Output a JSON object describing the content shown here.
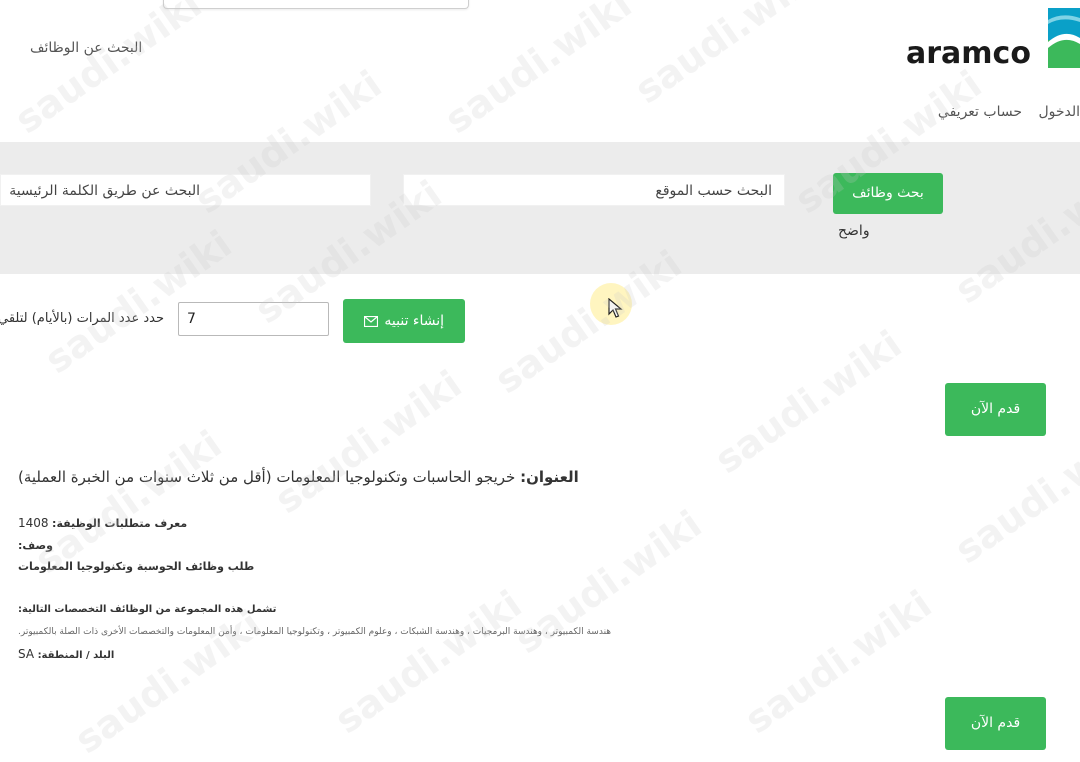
{
  "header": {
    "job_search_link": "البحث عن الوظائف",
    "logo_text": "aramco",
    "nav_items": [
      "الدخول",
      "حساب تعريفي"
    ]
  },
  "search": {
    "keyword_placeholder": "البحث عن طريق الكلمة الرئيسية",
    "location_placeholder": "البحث حسب الموقع",
    "search_button": "بحث وظائف",
    "clear_link": "واضح"
  },
  "alert": {
    "label": "حدد عدد المرات (بالأيام) لتلقي",
    "frequency_value": "7",
    "create_button": "إنشاء تنبيه"
  },
  "jobs": [
    {
      "apply_button": "قدم الآن",
      "title_label": "العنوان:",
      "title": "خريجو الحاسبات وتكنولوجيا المعلومات (أقل من ثلاث سنوات من الخبرة العملية)",
      "req_id_label": "معرف متطلبات الوظيفة:",
      "req_id": "1408",
      "description_label": "وصف:",
      "description": "طلب وظائف الحوسبة وتكنولوجيا المعلومات",
      "includes_label": "تشمل هذه المجموعة من الوظائف التخصصات التالية:",
      "includes_text": "هندسة الكمبيوتر ، وهندسة البرمجيات ، وهندسة الشبكات ، وعلوم الكمبيوتر ، وتكنولوجيا المعلومات ، وأمن المعلومات والتخصصات الأخرى ذات الصلة بالكمبيوتر.",
      "country_label": "البلد / المنطقة:",
      "country": "SA"
    },
    {
      "apply_button": "قدم الآن"
    }
  ],
  "watermark": "saudi.wiki",
  "colors": {
    "green_button": "#3cb95b",
    "search_band": "#ececec"
  },
  "icons": [
    "envelope-icon",
    "mouse-cursor-icon",
    "aramco-logo-mark"
  ]
}
